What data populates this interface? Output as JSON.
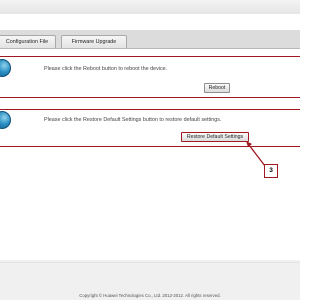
{
  "tabs": [
    {
      "label": "Configuration File"
    },
    {
      "label": "Firmware Upgrade"
    }
  ],
  "reboot": {
    "message": "Please click the Reboot button to reboot the device.",
    "button_label": "Reboot"
  },
  "restore": {
    "message": "Please click the Restore Default Settings button to restore default settings.",
    "button_label": "Restore Default Settings"
  },
  "callout": {
    "label": "3"
  },
  "footer": {
    "copyright": "Copyright © Huawei Technologies Co., Ltd. 2012-2012. All rights reserved."
  },
  "colors": {
    "highlight": "#a01822",
    "icon": "#2a8fc3"
  },
  "icons": {
    "panel_icon": "globe-icon"
  }
}
